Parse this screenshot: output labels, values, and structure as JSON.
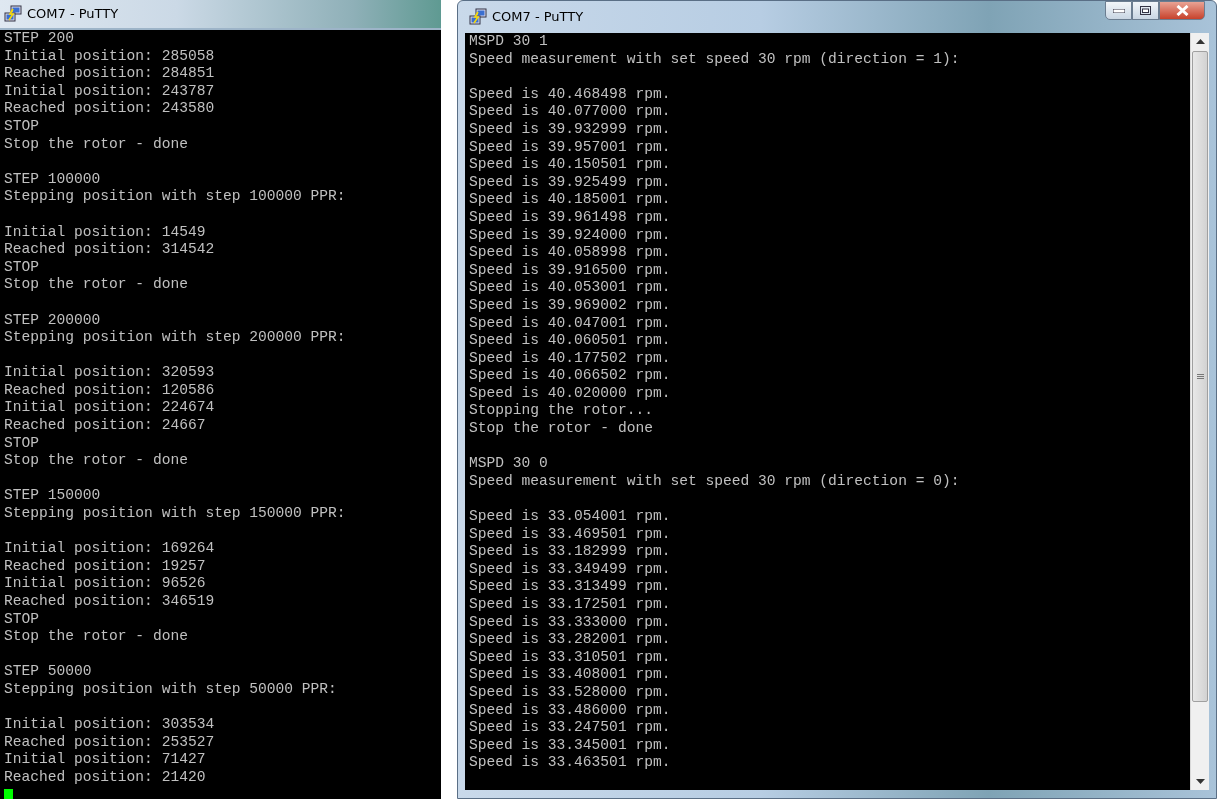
{
  "windows": [
    {
      "title": "COM7 - PuTTY",
      "controls": false,
      "scrollbar": false,
      "cursor_visible": true,
      "blocks": [
        [
          "STEP 200",
          "Initial position: 285058",
          "Reached position: 284851",
          "Initial position: 243787",
          "Reached position: 243580",
          "STOP",
          "Stop the rotor - done"
        ],
        [
          "STEP 100000",
          "Stepping position with step 100000 PPR:"
        ],
        [
          "Initial position: 14549",
          "Reached position: 314542",
          "STOP",
          "Stop the rotor - done"
        ],
        [
          "STEP 200000",
          "Stepping position with step 200000 PPR:"
        ],
        [
          "Initial position: 320593",
          "Reached position: 120586",
          "Initial position: 224674",
          "Reached position: 24667",
          "STOP",
          "Stop the rotor - done"
        ],
        [
          "STEP 150000",
          "Stepping position with step 150000 PPR:"
        ],
        [
          "Initial position: 169264",
          "Reached position: 19257",
          "Initial position: 96526",
          "Reached position: 346519",
          "STOP",
          "Stop the rotor - done"
        ],
        [
          "STEP 50000",
          "Stepping position with step 50000 PPR:"
        ],
        [
          "Initial position: 303534",
          "Reached position: 253527",
          "Initial position: 71427",
          "Reached position: 21420"
        ]
      ]
    },
    {
      "title": "COM7 - PuTTY",
      "controls": true,
      "scrollbar": true,
      "cursor_visible": false,
      "blocks": [
        [
          "MSPD 30 1",
          "Speed measurement with set speed 30 rpm (direction = 1):"
        ],
        [
          "Speed is 40.468498 rpm.",
          "Speed is 40.077000 rpm.",
          "Speed is 39.932999 rpm.",
          "Speed is 39.957001 rpm.",
          "Speed is 40.150501 rpm.",
          "Speed is 39.925499 rpm.",
          "Speed is 40.185001 rpm.",
          "Speed is 39.961498 rpm.",
          "Speed is 39.924000 rpm.",
          "Speed is 40.058998 rpm.",
          "Speed is 39.916500 rpm.",
          "Speed is 40.053001 rpm.",
          "Speed is 39.969002 rpm.",
          "Speed is 40.047001 rpm.",
          "Speed is 40.060501 rpm.",
          "Speed is 40.177502 rpm.",
          "Speed is 40.066502 rpm.",
          "Speed is 40.020000 rpm.",
          "Stopping the rotor...",
          "Stop the rotor - done"
        ],
        [
          "MSPD 30 0",
          "Speed measurement with set speed 30 rpm (direction = 0):"
        ],
        [
          "Speed is 33.054001 rpm.",
          "Speed is 33.469501 rpm.",
          "Speed is 33.182999 rpm.",
          "Speed is 33.349499 rpm.",
          "Speed is 33.313499 rpm.",
          "Speed is 33.172501 rpm.",
          "Speed is 33.333000 rpm.",
          "Speed is 33.282001 rpm.",
          "Speed is 33.310501 rpm.",
          "Speed is 33.408001 rpm.",
          "Speed is 33.528000 rpm.",
          "Speed is 33.486000 rpm.",
          "Speed is 33.247501 rpm.",
          "Speed is 33.345001 rpm.",
          "Speed is 33.463501 rpm."
        ]
      ]
    }
  ]
}
